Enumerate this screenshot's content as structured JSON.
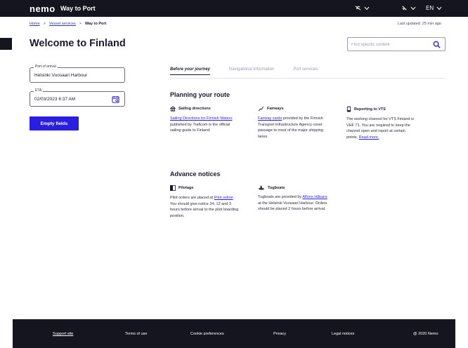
{
  "topbar": {
    "brand": "nemo",
    "product": "Way to Port",
    "language": "EN"
  },
  "breadcrumb": {
    "items": [
      "Home",
      "Vessel services",
      "Way to Port"
    ]
  },
  "updated": "Last updated: 25 min ago",
  "page_title": "Welcome to Finland",
  "search": {
    "placeholder": "Find specific content"
  },
  "form": {
    "port_label": "Port of arrival",
    "port_value": "Helsinki Vuosaari Harbour",
    "eta_label": "ETA",
    "eta_value": "02/03/2023  6:37 AM",
    "button": "Empty fields"
  },
  "tabs": [
    "Before your journey",
    "Navigational information",
    "Port services"
  ],
  "planning": {
    "heading": "Planning your route",
    "sailing": {
      "title": "Sailing directions",
      "link": "Sailing Directions for Finnish Waters",
      "text": " published by Traficom is the official sailing guide to Finland."
    },
    "fairways": {
      "title": "Fairways",
      "link": "Fairway cards",
      "text": " provided by the Finnish Transport Infrastructure Agency cover passage to most of the major shipping lanes."
    },
    "vts": {
      "title": "Reporting to VTS",
      "text": "The working channel for VTS Finland is VHF 71. You are required to keep the channel open and report at certain points. ",
      "link": "Read more."
    }
  },
  "notices": {
    "heading": "Advance notices",
    "pilotage": {
      "title": "Pilotage",
      "text1": "Pilot orders are placed at ",
      "link": "Pilot online",
      "text2": ". You should give notice 24, 12 and 3 hours before arrival to the pilot boarding position."
    },
    "tugboats": {
      "title": "Tugboats",
      "text1": "Tugboats are provided by ",
      "link": "Alfons Håkans",
      "text2": " at the Helsinki Vuosaari Harbour. Orders should be placed 2 hours before arrival."
    }
  },
  "footer": {
    "support": "Support site",
    "terms": "Terms of use",
    "cookies": "Cookie preferences",
    "privacy": "Privacy",
    "legal": "Legal notices",
    "copyright": "@ 2020 Nemo"
  }
}
